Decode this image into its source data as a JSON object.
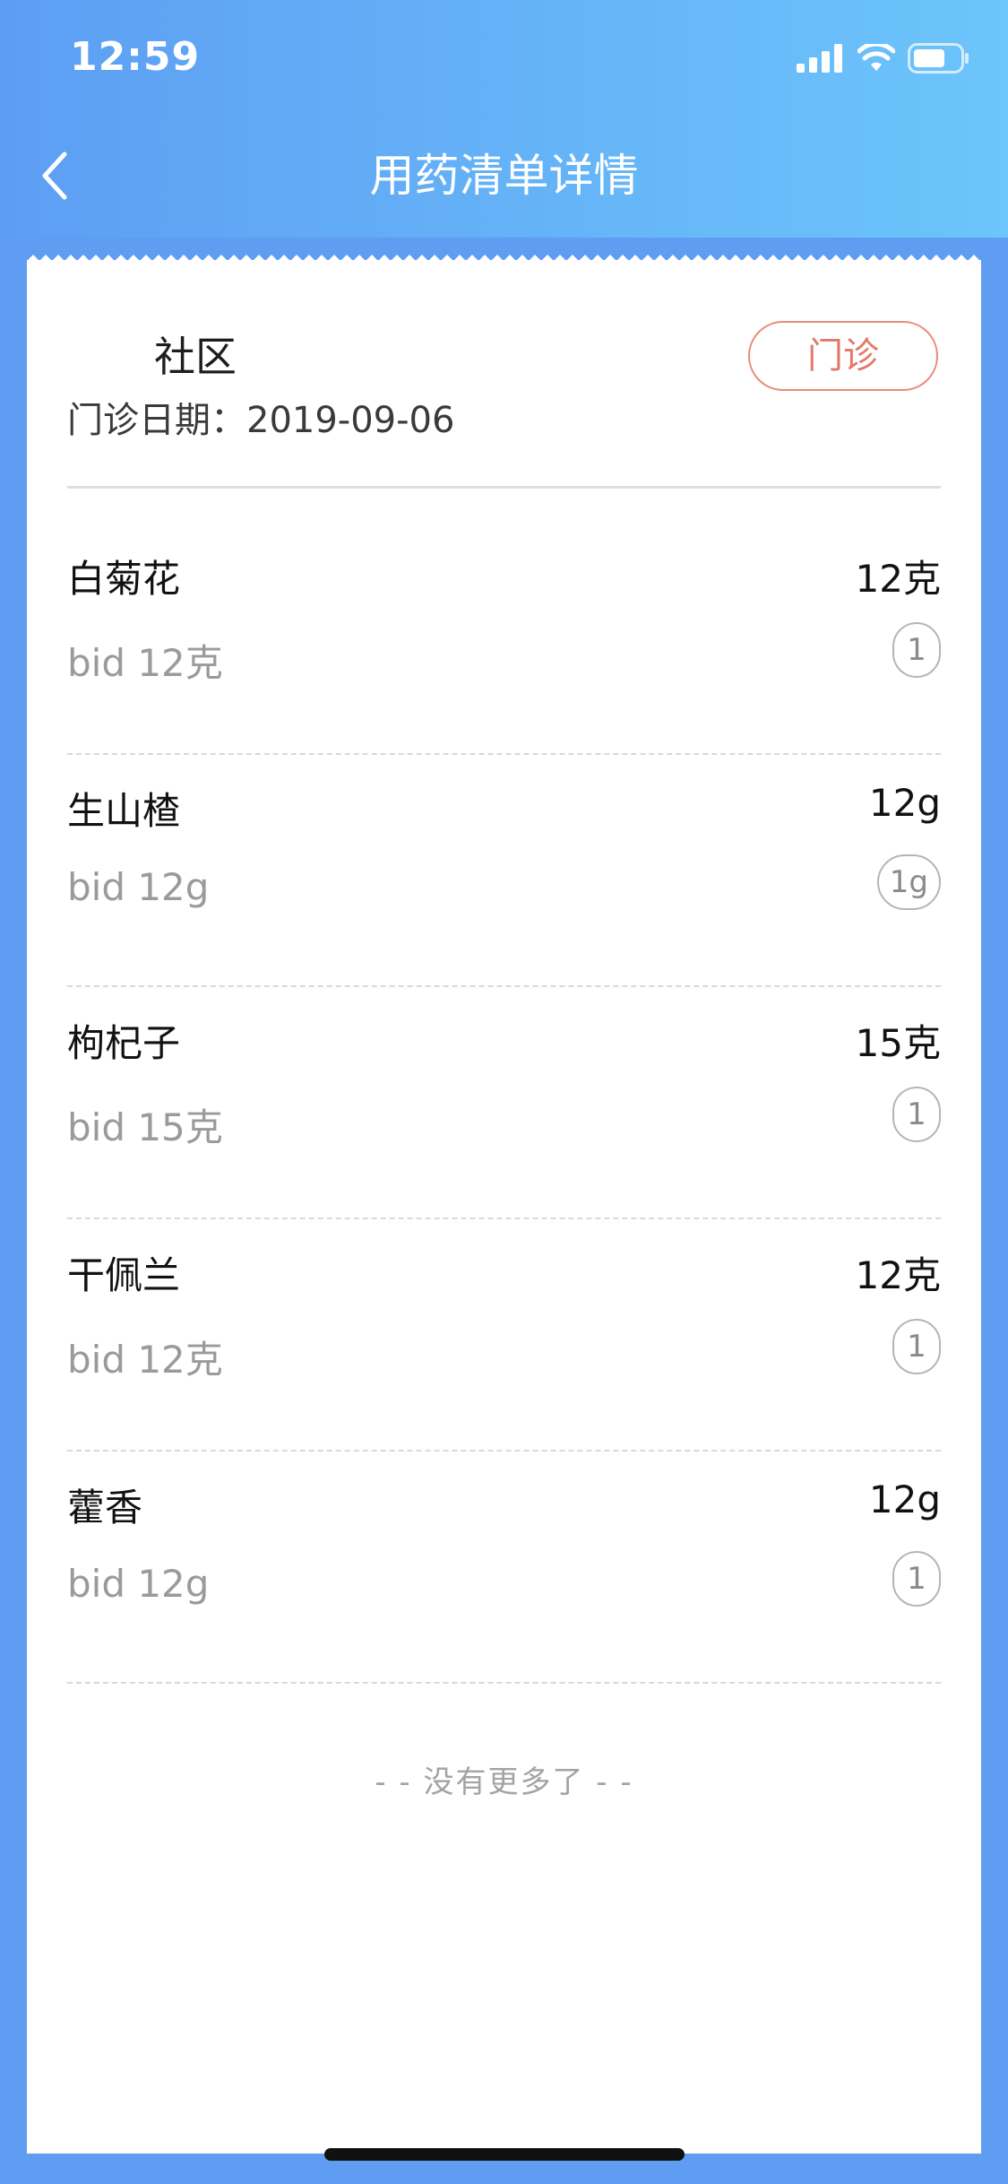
{
  "status_bar": {
    "time": "12:59"
  },
  "nav": {
    "title": "用药清单详情",
    "back_icon": "chevron-left-icon"
  },
  "header": {
    "clinic_name": "社区",
    "visit_date": "门诊日期：2019-09-06",
    "badge": "门诊",
    "badge_color": "#e5776a"
  },
  "medications": [
    {
      "name": "白菊花",
      "quantity": "12克",
      "usage": "bid 12克",
      "count": "1"
    },
    {
      "name": "生山楂",
      "quantity": "12g",
      "usage": "bid 12g",
      "count": "1g"
    },
    {
      "name": "枸杞子",
      "quantity": "15克",
      "usage": "bid 15克",
      "count": "1"
    },
    {
      "name": "干佩兰",
      "quantity": "12克",
      "usage": "bid 12克",
      "count": "1"
    },
    {
      "name": "藿香",
      "quantity": "12g",
      "usage": "bid 12g",
      "count": "1"
    }
  ],
  "footer": {
    "no_more": "- - 没有更多了 - -"
  },
  "colors": {
    "header_gradient_start": "#5d9ef3",
    "header_gradient_end": "#6cc5fb",
    "background": "#5f9df3"
  }
}
